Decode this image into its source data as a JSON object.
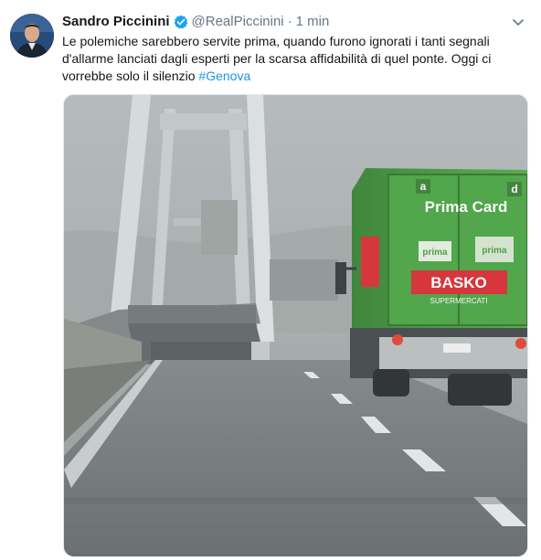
{
  "tweet": {
    "author_name": "Sandro Piccinini",
    "author_handle": "@RealPiccinini",
    "separator": "·",
    "timestamp": "1 min",
    "text_lines": [
      "Le polemiche sarebbero servite prima, quando furono ignorati i tanti segnali",
      "d'allarme lanciati dagli esperti per la scarsa affidabilità di quel ponte. Oggi ci",
      "vorrebbe solo il silenzio "
    ],
    "hashtag": "#Genova"
  },
  "photo": {
    "truck_logo_text": "Prima Card",
    "truck_store_text": "BASKO",
    "truck_sub_text": "SUPERMERCATI",
    "truck_panel_left": "prima",
    "truck_panel_right": "prima",
    "truck_corner_left": "a",
    "truck_corner_right": "d"
  },
  "icons": {
    "verified": "verified-badge-icon",
    "menu": "chevron-down-icon"
  },
  "colors": {
    "link": "#1b95e0",
    "verified": "#1da1f2",
    "secondary_text": "#657786",
    "truck_green": "#3f9a35",
    "truck_red": "#d8232a"
  }
}
